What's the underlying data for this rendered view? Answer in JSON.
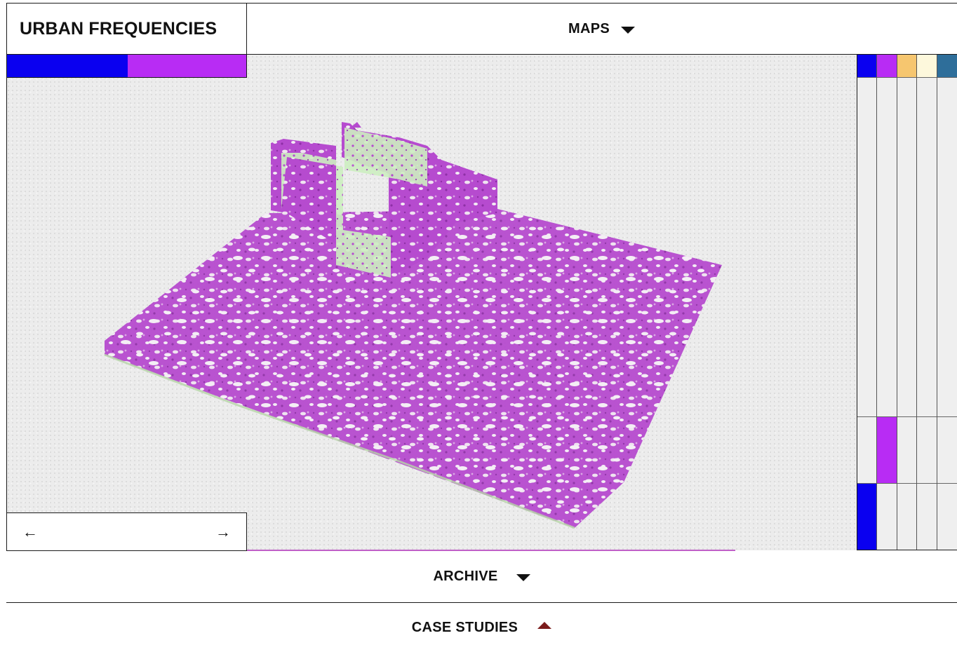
{
  "header": {
    "brand": "URBAN FREQUENCIES",
    "maps_label": "MAPS"
  },
  "swatches": {
    "left_strip": [
      "#0a00f0",
      "#b82cf4"
    ],
    "palette": [
      "#0a00f0",
      "#b82cf4",
      "#f6c66f",
      "#fdf8dc",
      "#2e6e9a"
    ]
  },
  "viewer": {
    "point_cloud_color": "#b64bcf",
    "facade_color": "#cdeec1",
    "background": "#ececec"
  },
  "pager": {
    "prev_icon": "arrow-left",
    "prev_glyph": "←",
    "next_icon": "arrow-right",
    "next_glyph": "→"
  },
  "right_grid": {
    "highlight_mid": "#b82cf4",
    "highlight_low": "#0a00f0"
  },
  "sections": {
    "archive_label": "ARCHIVE",
    "case_studies_label": "CASE STUDIES",
    "case_studies_arrow_color": "#7b1b1b"
  }
}
